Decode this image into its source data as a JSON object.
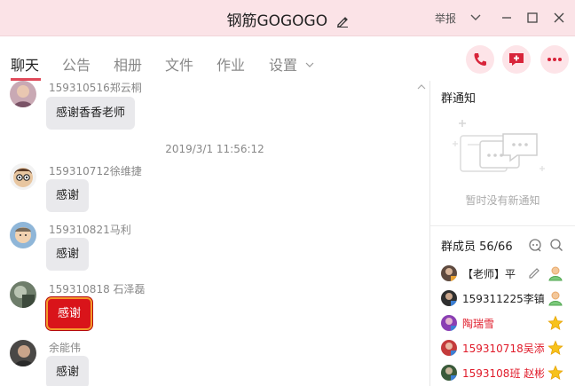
{
  "window": {
    "title": "钢筋GOGOGO",
    "report_label": "举报"
  },
  "tabs": [
    {
      "label": "聊天",
      "active": true
    },
    {
      "label": "公告"
    },
    {
      "label": "相册"
    },
    {
      "label": "文件"
    },
    {
      "label": "作业"
    },
    {
      "label": "设置"
    }
  ],
  "chat": {
    "timestamp": "2019/3/1 11:56:12",
    "messages": [
      {
        "sender": "159310516郑云桐",
        "text": "感谢香香老师"
      },
      {
        "sender": "159310712徐维捷",
        "text": "感谢"
      },
      {
        "sender": "159310821马利",
        "text": "感谢"
      },
      {
        "sender": "159310818  石泽磊",
        "text": "感谢",
        "style": "red"
      },
      {
        "sender": "余能伟",
        "text": "感谢"
      }
    ]
  },
  "notice": {
    "title": "群通知",
    "empty_text": "暂时没有新通知"
  },
  "members": {
    "title": "群成员 56/66",
    "items": [
      {
        "name": "【老师】平",
        "color": "#222222",
        "badge": "teacher"
      },
      {
        "name": "159311225李镇",
        "color": "#222222",
        "badge": "admin"
      },
      {
        "name": "陶瑞雪",
        "color": "#e01b2a",
        "badge": "star"
      },
      {
        "name": "159310718吴添",
        "color": "#e01b2a",
        "badge": "star"
      },
      {
        "name": "1593108班 赵彬",
        "color": "#e01b2a",
        "badge": "star"
      }
    ]
  },
  "colors": {
    "titlebar_bg": "#fbe3e7",
    "accent": "#e04a5a",
    "red_bubble": "#d9141a"
  }
}
